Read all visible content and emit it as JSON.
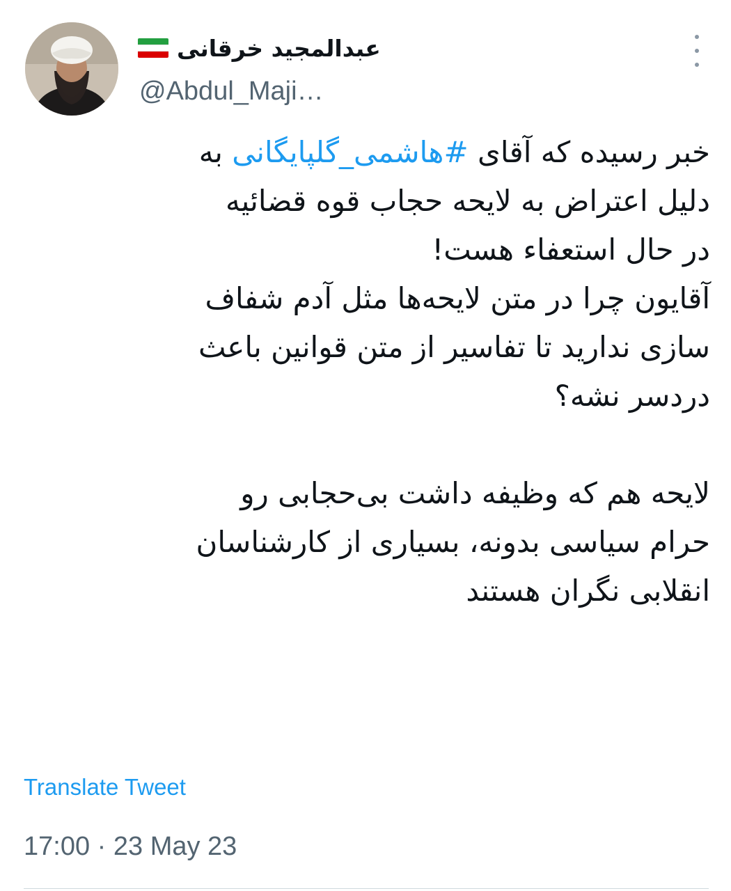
{
  "author": {
    "display_name": "عبدالمجید خرقانی",
    "handle": "@Abdul_Maji…",
    "flag_colors": [
      "#239f40",
      "#ffffff",
      "#da0000"
    ]
  },
  "tweet": {
    "lines_before_hashtag": "خبر رسیده که آقای ",
    "hashtag": "#هاشمی_گلپایگانی",
    "line1_after_hashtag": " به",
    "lines": [
      "دلیل اعتراض به لایحه حجاب قوه قضائیه",
      "در حال استعفاء هست!",
      "آقایون چرا در متن لایحه‌ها مثل آدم شفاف",
      "سازی ندارید تا تفاسیر از متن قوانین باعث",
      "دردسر نشه؟"
    ],
    "lines_after_gap": [
      "لایحه هم که وظیفه داشت بی‌حجابی رو",
      "حرام سیاسی بدونه، بسیاری از کارشناسان",
      "انقلابی نگران هستند"
    ],
    "translate_label": "Translate Tweet",
    "timestamp": "17:00 · 23 May 23"
  },
  "icons": {
    "more": "more-vertical-icon",
    "flag": "iran-flag-icon"
  },
  "colors": {
    "text": "#0f1419",
    "secondary": "#536471",
    "link": "#1d9bf0"
  }
}
